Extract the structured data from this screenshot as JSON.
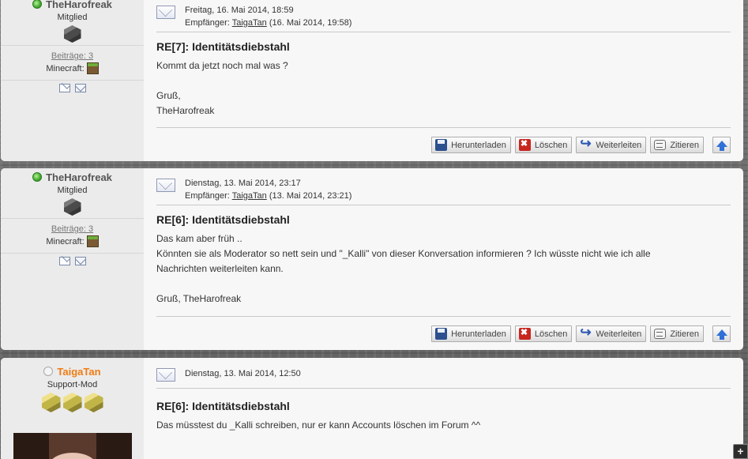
{
  "posts": [
    {
      "user": {
        "name": "TheHarofreak",
        "rank": "Mitglied",
        "posts_label": "Beiträge: 3",
        "game_label": "Minecraft:",
        "status": "online"
      },
      "date": "Freitag, 16. Mai 2014, 18:59",
      "recipient_label": "Empfänger:",
      "recipient_name": "TaigaTan",
      "recipient_time": " (16. Mai 2014, 19:58)",
      "title": "RE[7]: Identitätsdiebstahl",
      "body": [
        "Kommt da jetzt noch mal was ?",
        "",
        "Gruß,",
        "TheHarofreak"
      ]
    },
    {
      "user": {
        "name": "TheHarofreak",
        "rank": "Mitglied",
        "posts_label": "Beiträge: 3",
        "game_label": "Minecraft:",
        "status": "online"
      },
      "date": "Dienstag, 13. Mai 2014, 23:17",
      "recipient_label": "Empfänger:",
      "recipient_name": "TaigaTan",
      "recipient_time": " (13. Mai 2014, 23:21)",
      "title": "RE[6]: Identitätsdiebstahl",
      "body": [
        "Das kam aber früh ..",
        "Könnten sie als Moderator so nett sein und \"_Kalli\" von dieser Konversation informieren ? Ich wüsste nicht wie ich alle",
        "Nachrichten weiterleiten kann.",
        "",
        "Gruß, TheHarofreak"
      ]
    },
    {
      "user": {
        "name": "TaigaTan",
        "rank": "Support-Mod",
        "status": "offline"
      },
      "date": "Dienstag, 13. Mai 2014, 12:50",
      "title": "RE[6]: Identitätsdiebstahl",
      "body": [
        "Das müsstest du _Kalli schreiben, nur er kann Accounts löschen im Forum ^^"
      ]
    }
  ],
  "actions": {
    "download": "Herunterladen",
    "delete": "Löschen",
    "forward": "Weiterleiten",
    "quote": "Zitieren"
  },
  "corner": {
    "label": "+"
  }
}
